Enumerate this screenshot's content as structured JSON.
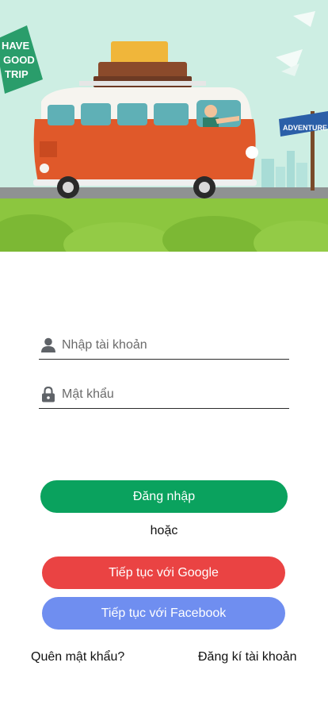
{
  "hero": {
    "alt_graphic": "travel-van-illustration",
    "signs": [
      "HAVE A GOOD TRIP",
      "ADVENTURE"
    ]
  },
  "form": {
    "username": {
      "placeholder": "Nhập tài khoản",
      "value": "",
      "icon": "person-icon"
    },
    "password": {
      "placeholder": "Mật khẩu",
      "value": "",
      "icon": "lock-icon"
    }
  },
  "actions": {
    "login_label": "Đăng nhập",
    "or_label": "hoặc",
    "google_label": "Tiếp tục với Google",
    "facebook_label": "Tiếp tục với Facebook"
  },
  "links": {
    "forgot_label": "Quên mật khẩu?",
    "register_label": "Đăng kí tài khoản"
  },
  "colors": {
    "login": "#0aa25e",
    "google": "#ea4343",
    "facebook": "#6f8ef0",
    "sky": "#cfeee4",
    "grass": "#8cc63f"
  }
}
